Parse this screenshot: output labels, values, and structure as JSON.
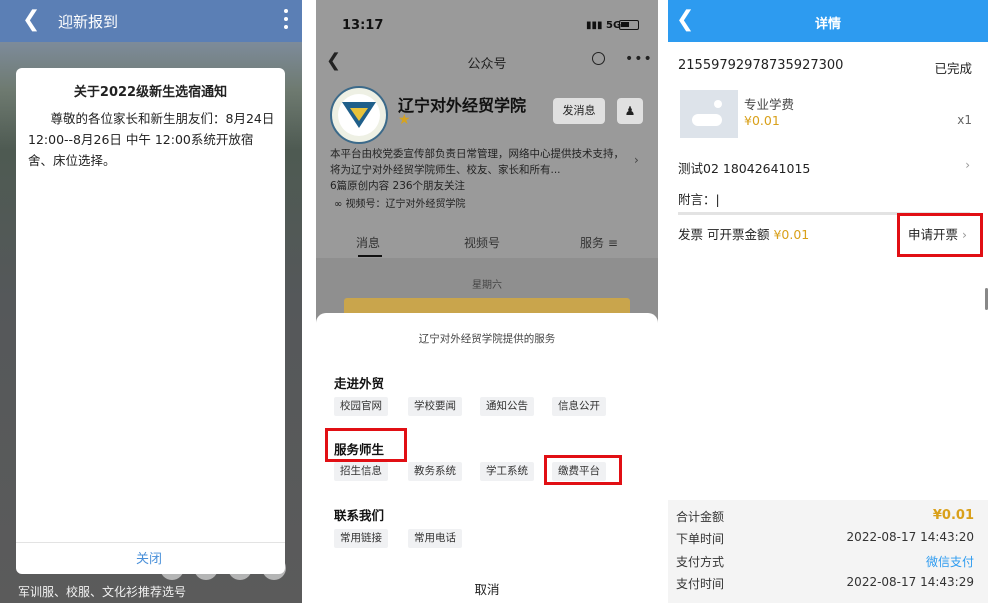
{
  "panel1": {
    "header_title": "迎新报到",
    "dialog": {
      "title": "关于2022级新生选宿通知",
      "body": "尊敬的各位家长和新生朋友们：8月24日12:00--8月26日 中午 12:00系统开放宿舍、床位选择。",
      "close_label": "关闭"
    },
    "bottom_text": "军训服、校服、文化衫推荐选号"
  },
  "panel2": {
    "status_time": "13:17",
    "status_signal": "5G",
    "nav_title": "公众号",
    "account_name": "辽宁对外经贸学院",
    "follow_button": "发消息",
    "description": "本平台由校党委宣传部负责日常管理，网络中心提供技术支持，将为辽宁对外经贸学院师生、校友、家长和所有...",
    "stats": "6篇原创内容    236个朋友关注",
    "channel": "视频号：辽宁对外经贸学院",
    "tabs": [
      "消息",
      "视频号",
      "服务"
    ],
    "feed_day": "星期六",
    "sheet": {
      "title": "辽宁对外经贸学院提供的服务",
      "sections": [
        {
          "name": "走进外贸",
          "chips": [
            "校园官网",
            "学校要闻",
            "通知公告",
            "信息公开"
          ]
        },
        {
          "name": "服务师生",
          "chips": [
            "招生信息",
            "教务系统",
            "学工系统",
            "缴费平台"
          ]
        },
        {
          "name": "联系我们",
          "chips": [
            "常用链接",
            "常用电话"
          ]
        }
      ],
      "cancel_label": "取消"
    }
  },
  "panel3": {
    "header_title": "详情",
    "order_number": "21559792978735927300",
    "order_status": "已完成",
    "item": {
      "name": "专业学费",
      "price": "¥0.01",
      "qty": "x1"
    },
    "contact": "测试02    18042641015",
    "note_label": "附言：|",
    "invoice_label": "发票  可开票金额",
    "invoice_amount": "¥0.01",
    "apply_label": "申请开票",
    "summary": [
      {
        "label": "合计金额",
        "value": "¥0.01"
      },
      {
        "label": "下单时间",
        "value": "2022-08-17 14:43:20"
      },
      {
        "label": "支付方式",
        "value": "微信支付"
      },
      {
        "label": "支付时间",
        "value": "2022-08-17 14:43:29"
      }
    ]
  },
  "colors": {
    "panel1_header": "#5b7fb5",
    "panel3_header": "#2d9bf0",
    "highlight_red": "#e10f14",
    "price_gold": "#d9a01a",
    "link_blue": "#2d9bf0"
  }
}
